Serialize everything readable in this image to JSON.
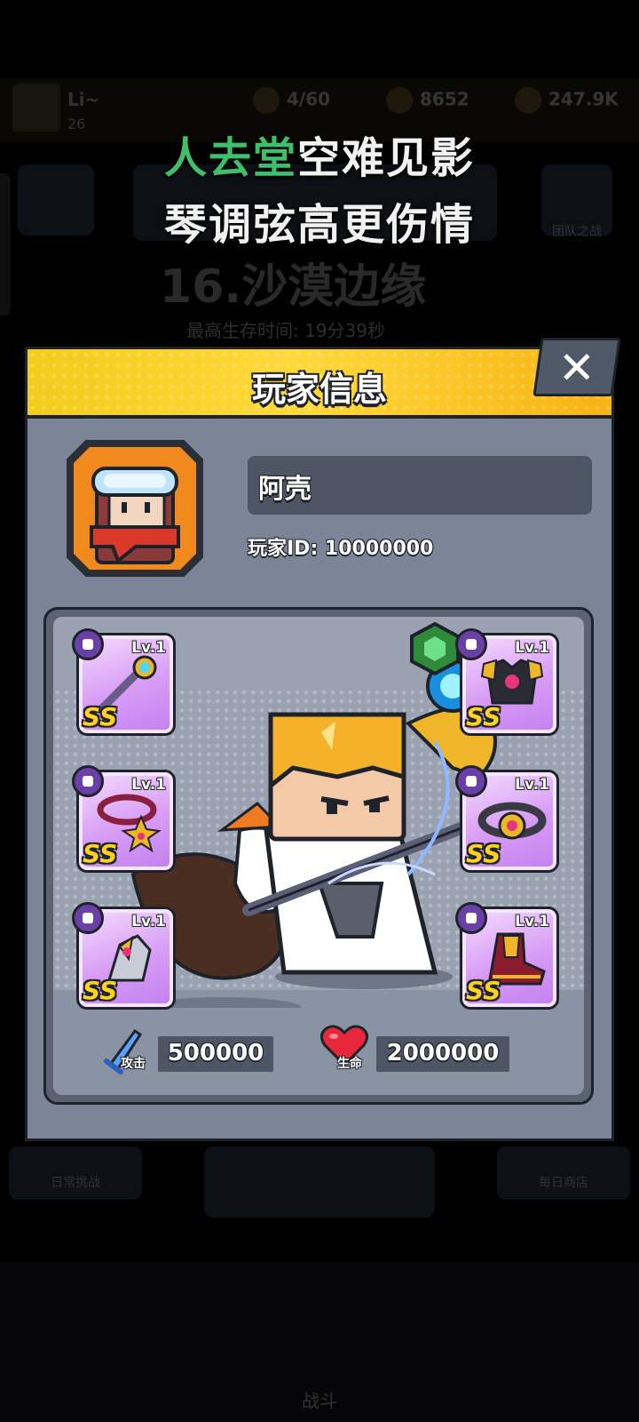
{
  "caption": {
    "line1_highlight": "人去堂",
    "line1_rest": "空难见影",
    "line2": "琴调弦高更伤情"
  },
  "background": {
    "player_name": "Li~",
    "player_level": "26",
    "stamina": "4/60",
    "coins": "8652",
    "gems": "247.9K",
    "stage_title": "16.沙漠边缘",
    "best_time": "最高生存时间: 19分39秒",
    "guard_label": "团队之战",
    "daily_label": "日常挑战",
    "shop_label": "每日商店",
    "battle_label": "战斗"
  },
  "dialog": {
    "title": "玩家信息",
    "close_icon": "close-icon",
    "player": {
      "name": "阿壳",
      "id_label": "玩家ID: 10000000"
    },
    "equipment": [
      {
        "slot": "weapon",
        "level": "Lv.1",
        "grade": "SS",
        "icon": "staff-icon"
      },
      {
        "slot": "armor",
        "level": "Lv.1",
        "grade": "SS",
        "icon": "armor-icon"
      },
      {
        "slot": "necklace",
        "level": "Lv.1",
        "grade": "SS",
        "icon": "necklace-icon"
      },
      {
        "slot": "belt",
        "level": "Lv.1",
        "grade": "SS",
        "icon": "belt-icon"
      },
      {
        "slot": "gloves",
        "level": "Lv.1",
        "grade": "SS",
        "icon": "gloves-icon"
      },
      {
        "slot": "boots",
        "level": "Lv.1",
        "grade": "SS",
        "icon": "boots-icon"
      }
    ],
    "stats": {
      "attack_label": "攻击",
      "attack_value": "500000",
      "hp_label": "生命",
      "hp_value": "2000000"
    }
  },
  "colors": {
    "header_yellow": "#f4cc1b",
    "panel_gray": "#7b8597",
    "slot_purple": "#d79cf5",
    "grade_gold": "#ffd21e",
    "caption_green": "#3dbf6b"
  }
}
